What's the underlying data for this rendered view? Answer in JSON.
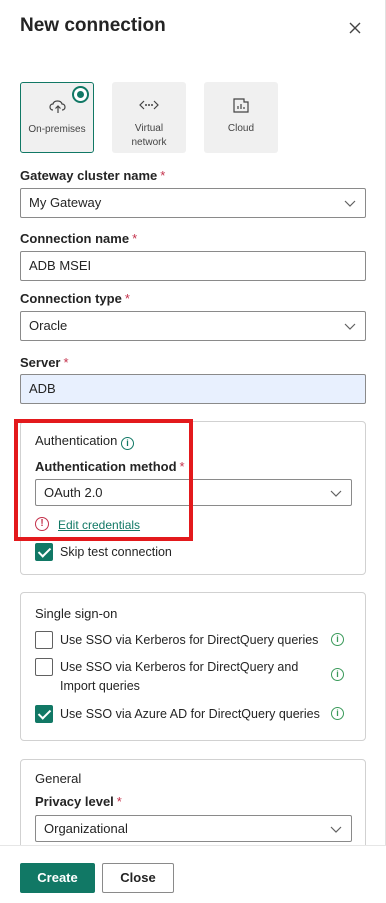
{
  "dialog": {
    "title": "New connection"
  },
  "connection_types": [
    {
      "label": "On-premises",
      "icon": "cloud-upload-icon",
      "selected": true
    },
    {
      "label": "Virtual network",
      "icon": "virtual-network-icon",
      "selected": false
    },
    {
      "label": "Cloud",
      "icon": "cloud-report-icon",
      "selected": false
    }
  ],
  "gateway": {
    "label": "Gateway cluster name",
    "required": "*",
    "value": "My Gateway"
  },
  "connection_name": {
    "label": "Connection name",
    "required": "*",
    "value": "ADB MSEI"
  },
  "connection_type": {
    "label": "Connection type",
    "required": "*",
    "value": "Oracle"
  },
  "server": {
    "label": "Server",
    "required": "*",
    "value": "ADB"
  },
  "authentication": {
    "heading": "Authentication",
    "method_label": "Authentication method",
    "required": "*",
    "method_value": "OAuth 2.0",
    "edit_link": "Edit credentials",
    "skip_test_label": "Skip test connection",
    "skip_test_checked": true
  },
  "sso": {
    "heading": "Single sign-on",
    "options": [
      {
        "label": "Use SSO via Kerberos for DirectQuery queries",
        "checked": false
      },
      {
        "label_line1": "Use SSO via Kerberos for DirectQuery and",
        "label_line2": "Import queries",
        "checked": false
      },
      {
        "label": "Use SSO via Azure AD for DirectQuery queries",
        "checked": true
      }
    ]
  },
  "general": {
    "heading": "General",
    "privacy_label": "Privacy level",
    "required": "*",
    "privacy_value": "Organizational"
  },
  "footer": {
    "create_label": "Create",
    "close_label": "Close"
  },
  "colors": {
    "accent": "#117865",
    "error": "#c4314b",
    "highlight_box": "#e3191c"
  }
}
